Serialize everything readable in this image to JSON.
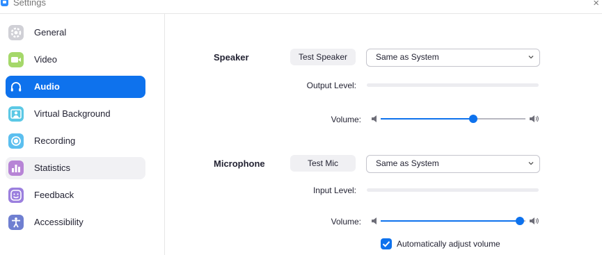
{
  "window": {
    "title": "Settings",
    "close_glyph": "×",
    "app_icon": "zoom-icon"
  },
  "sidebar": {
    "items": [
      {
        "label": "General",
        "icon": "gear-icon",
        "color": "#d0d0d6"
      },
      {
        "label": "Video",
        "icon": "video-camera-icon",
        "color": "#a5d86a"
      },
      {
        "label": "Audio",
        "icon": "headphones-icon",
        "color": "#0e72ed"
      },
      {
        "label": "Virtual Background",
        "icon": "person-background-icon",
        "color": "#5bc8e5"
      },
      {
        "label": "Recording",
        "icon": "record-icon",
        "color": "#5bbfef"
      },
      {
        "label": "Statistics",
        "icon": "bar-chart-icon",
        "color": "#b784d6"
      },
      {
        "label": "Feedback",
        "icon": "smiley-icon",
        "color": "#9b7fde"
      },
      {
        "label": "Accessibility",
        "icon": "accessibility-icon",
        "color": "#6f7fd1"
      }
    ],
    "active": "Audio",
    "hovered": "Statistics"
  },
  "speaker": {
    "label": "Speaker",
    "test_button": "Test Speaker",
    "device": "Same as System",
    "output_level_label": "Output Level:",
    "volume_label": "Volume:",
    "volume_fraction": 0.64
  },
  "microphone": {
    "label": "Microphone",
    "test_button": "Test Mic",
    "device": "Same as System",
    "input_level_label": "Input Level:",
    "volume_label": "Volume:",
    "volume_fraction": 0.96,
    "auto_adjust_label": "Automatically adjust volume",
    "auto_adjust_checked": true
  },
  "colors": {
    "accent": "#0e72ed",
    "sidebar_hover": "#f1f1f4",
    "pill": "#f0f0f3"
  }
}
